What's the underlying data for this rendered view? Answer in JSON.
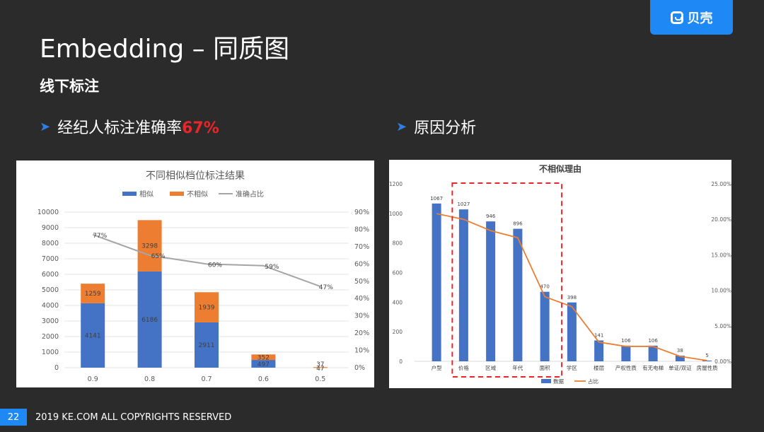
{
  "brand": {
    "logo_text": "贝壳"
  },
  "title": "Embedding – 同质图",
  "subtitle": "线下标注",
  "bullet1": {
    "text": "经纪人标注准确率",
    "highlight": "67%"
  },
  "bullet2": {
    "text": "原因分析"
  },
  "footer": {
    "page": "22",
    "copyright": "2019 KE.COM ALL COPYRIGHTS RESERVED"
  },
  "colors": {
    "blue": "#4472c4",
    "orange": "#ed7d31",
    "gray": "#a5a5a5",
    "accent": "#1e88f5",
    "highlight": "#e8262a"
  },
  "chart_data": [
    {
      "type": "bar",
      "stacked": true,
      "title": "不同相似档位标注结果",
      "categories": [
        "0.9",
        "0.8",
        "0.7",
        "0.6",
        "0.5"
      ],
      "series": [
        {
          "name": "相似",
          "type": "bar",
          "values": [
            4141,
            6186,
            2911,
            497,
            0
          ]
        },
        {
          "name": "不相似",
          "type": "bar",
          "values": [
            1259,
            3298,
            1939,
            352,
            37
          ]
        },
        {
          "name": "准确占比",
          "type": "line",
          "axis": "right",
          "values": [
            77,
            65,
            60,
            59,
            47
          ],
          "labels": [
            "77%",
            "65%",
            "60%",
            "59%",
            "47%"
          ]
        }
      ],
      "data_labels_extra": [
        "47"
      ],
      "ylim": [
        0,
        10000
      ],
      "yticks": [
        0,
        1000,
        2000,
        3000,
        4000,
        5000,
        6000,
        7000,
        8000,
        9000,
        10000
      ],
      "y2lim": [
        0,
        90
      ],
      "y2ticks": [
        "0%",
        "10%",
        "20%",
        "30%",
        "40%",
        "50%",
        "60%",
        "70%",
        "80%",
        "90%"
      ],
      "legend": "top"
    },
    {
      "type": "bar",
      "title": "不相似理由",
      "categories": [
        "户型",
        "价格",
        "区域",
        "年代",
        "面积",
        "学区",
        "楼层",
        "产权性质",
        "有无电梯",
        "单证/双证",
        "房屋性质"
      ],
      "series": [
        {
          "name": "数据",
          "type": "bar",
          "values": [
            1067,
            1027,
            946,
            896,
            470,
            398,
            141,
            106,
            106,
            38,
            5
          ]
        },
        {
          "name": "占比",
          "type": "line",
          "axis": "right",
          "values": [
            20.8,
            20.0,
            18.4,
            17.4,
            9.1,
            7.7,
            2.7,
            2.1,
            2.1,
            0.7,
            0.1
          ]
        }
      ],
      "ylim": [
        0,
        1200
      ],
      "yticks": [
        0,
        200,
        400,
        600,
        800,
        1000,
        1200
      ],
      "y2lim": [
        0,
        25
      ],
      "y2ticks": [
        "0.00%",
        "5.00%",
        "10.00%",
        "15.00%",
        "20.00%",
        "25.00%"
      ],
      "highlight_box": [
        "价格",
        "面积"
      ],
      "legend": "bottom"
    }
  ]
}
